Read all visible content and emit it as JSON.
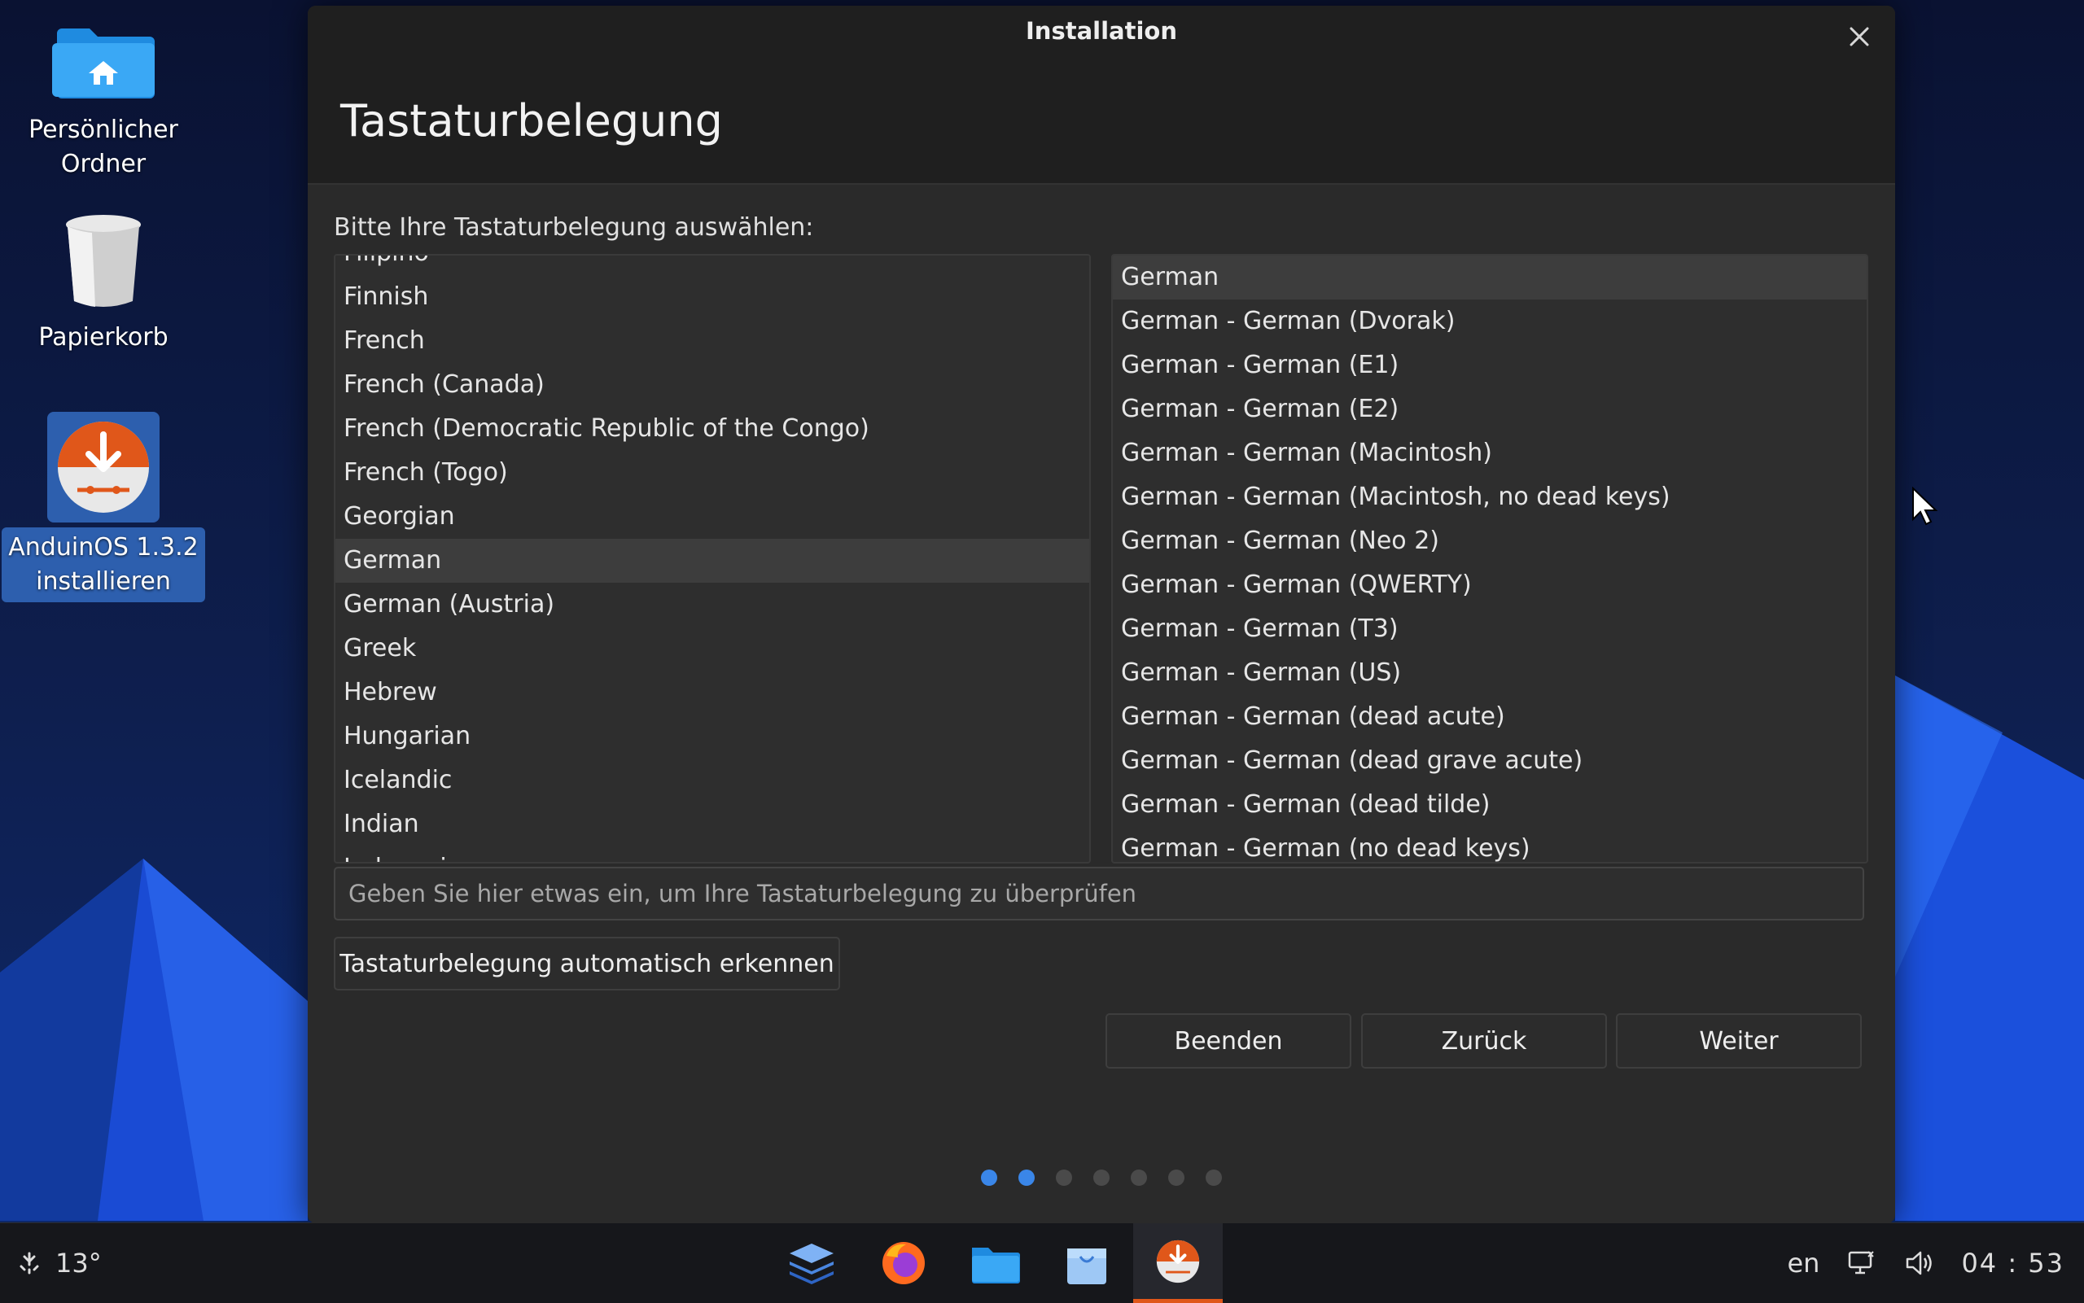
{
  "desktop": {
    "icons": [
      {
        "label": "Persönlicher Ordner"
      },
      {
        "label": "Papierkorb"
      },
      {
        "label": "AnduinOS 1.3.2 installieren"
      }
    ]
  },
  "window": {
    "title": "Installation",
    "heading": "Tastaturbelegung",
    "prompt": "Bitte Ihre Tastaturbelegung auswählen:",
    "layouts": [
      "Filipino",
      "Finnish",
      "French",
      "French (Canada)",
      "French (Democratic Republic of the Congo)",
      "French (Togo)",
      "Georgian",
      "German",
      "German (Austria)",
      "Greek",
      "Hebrew",
      "Hungarian",
      "Icelandic",
      "Indian",
      "Indonesian"
    ],
    "selected_layout": "German",
    "variants": [
      "German",
      "German - German (Dvorak)",
      "German - German (E1)",
      "German - German (E2)",
      "German - German (Macintosh)",
      "German - German (Macintosh, no dead keys)",
      "German - German (Neo 2)",
      "German - German (QWERTY)",
      "German - German (T3)",
      "German - German (US)",
      "German - German (dead acute)",
      "German - German (dead grave acute)",
      "German - German (dead tilde)",
      "German - German (no dead keys)"
    ],
    "selected_variant": "German",
    "test_placeholder": "Geben Sie hier etwas ein, um Ihre Tastaturbelegung zu überprüfen",
    "detect_label": "Tastaturbelegung automatisch erkennen",
    "quit_label": "Beenden",
    "back_label": "Zurück",
    "next_label": "Weiter",
    "steps_total": 7,
    "steps_done": 2
  },
  "taskbar": {
    "temperature": "13°",
    "apps": [
      "layers-icon",
      "firefox-icon",
      "files-icon",
      "store-icon",
      "installer-icon"
    ],
    "active_app": "installer-icon",
    "language": "en",
    "clock": "04 : 53"
  },
  "colors": {
    "accent": "#3a86e8",
    "installer": "#e0571a"
  }
}
